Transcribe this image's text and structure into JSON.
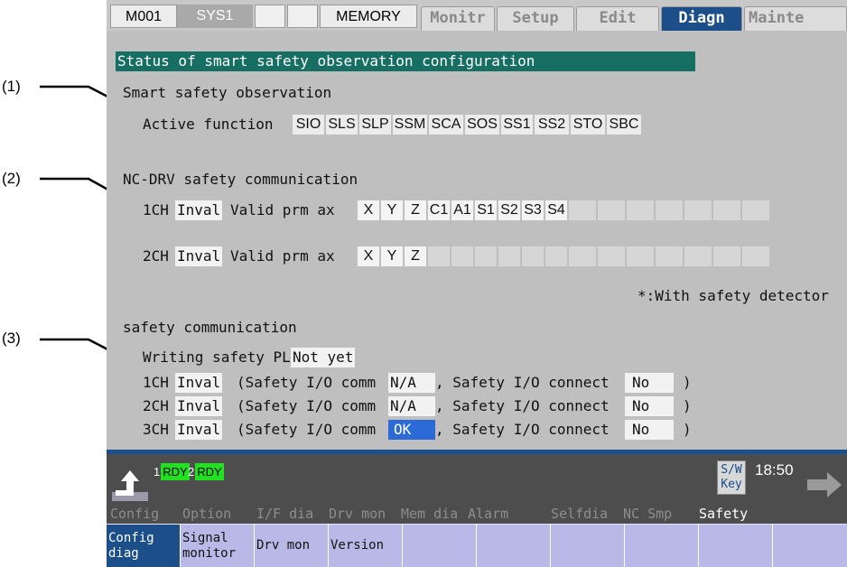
{
  "callouts": [
    "(1)",
    "(2)",
    "(3)"
  ],
  "topbar": {
    "mode": "M001",
    "system": "SYS1",
    "memory": "MEMORY",
    "tabs": [
      {
        "label": "Monitr",
        "active": false
      },
      {
        "label": "Setup",
        "active": false
      },
      {
        "label": "Edit",
        "active": false
      },
      {
        "label": "Diagn",
        "active": true
      },
      {
        "label": "Mainte",
        "active": false
      }
    ]
  },
  "screen": {
    "title": "Status of smart safety observation configuration",
    "observation": {
      "heading": "Smart safety observation",
      "label": "Active function",
      "functions": [
        "SIO",
        "SLS",
        "SLP",
        "SSM",
        "SCA",
        "SOS",
        "SS1",
        "SS2",
        "STO",
        "SBC"
      ]
    },
    "ncdrv": {
      "heading": "NC-DRV safety communication",
      "ch1": {
        "label": "1CH",
        "status": "Inval",
        "prm_label": "Valid prm ax",
        "axes": [
          "X",
          "Y",
          "Z",
          "C1",
          "A1",
          "S1",
          "S2",
          "S3",
          "S4"
        ]
      },
      "ch2": {
        "label": "2CH",
        "status": "Inval",
        "prm_label": "Valid prm ax",
        "axes": [
          "X",
          "Y",
          "Z"
        ]
      },
      "note": "*:With safety detector"
    },
    "comm": {
      "heading": "safety communication",
      "writing_label": "Writing safety PLC",
      "writing_value": "Not yet",
      "rows": [
        {
          "ch": "1CH",
          "status": "Inval",
          "comm_label": "(Safety I/O comm",
          "comm_value": "N/A",
          "connect_label": ", Safety I/O connect",
          "connect_value": "No",
          "close": ")"
        },
        {
          "ch": "2CH",
          "status": "Inval",
          "comm_label": "(Safety I/O comm",
          "comm_value": "N/A",
          "connect_label": ", Safety I/O connect",
          "connect_value": "No",
          "close": ")"
        },
        {
          "ch": "3CH",
          "status": "Inval",
          "comm_label": "(Safety I/O comm",
          "comm_value": "OK",
          "connect_label": ", Safety I/O connect",
          "connect_value": "No",
          "close": ")"
        }
      ]
    }
  },
  "status": {
    "ready": [
      {
        "num": "1",
        "lamp": "RDY"
      },
      {
        "num": "2",
        "lamp": "RDY"
      }
    ],
    "swkey_line1": "S/W",
    "swkey_line2": "Key",
    "time": "18:50"
  },
  "menu": [
    "Config",
    "Option",
    "I/F dia",
    "Drv mon",
    "Mem dia",
    "Alarm",
    "Selfdia",
    "NC Smp",
    "Safety"
  ],
  "softkeys": [
    "Config\ndiag",
    "Signal\nmonitor",
    "Drv mon",
    "Version",
    "",
    "",
    "",
    "",
    "",
    ""
  ],
  "colors": {
    "title_bar": "#176e63",
    "active_tab": "#1c4f8a",
    "ready_lamp": "#20e020",
    "ok_box": "#2c6ad8",
    "softkey_bg": "#b9b9e8"
  }
}
